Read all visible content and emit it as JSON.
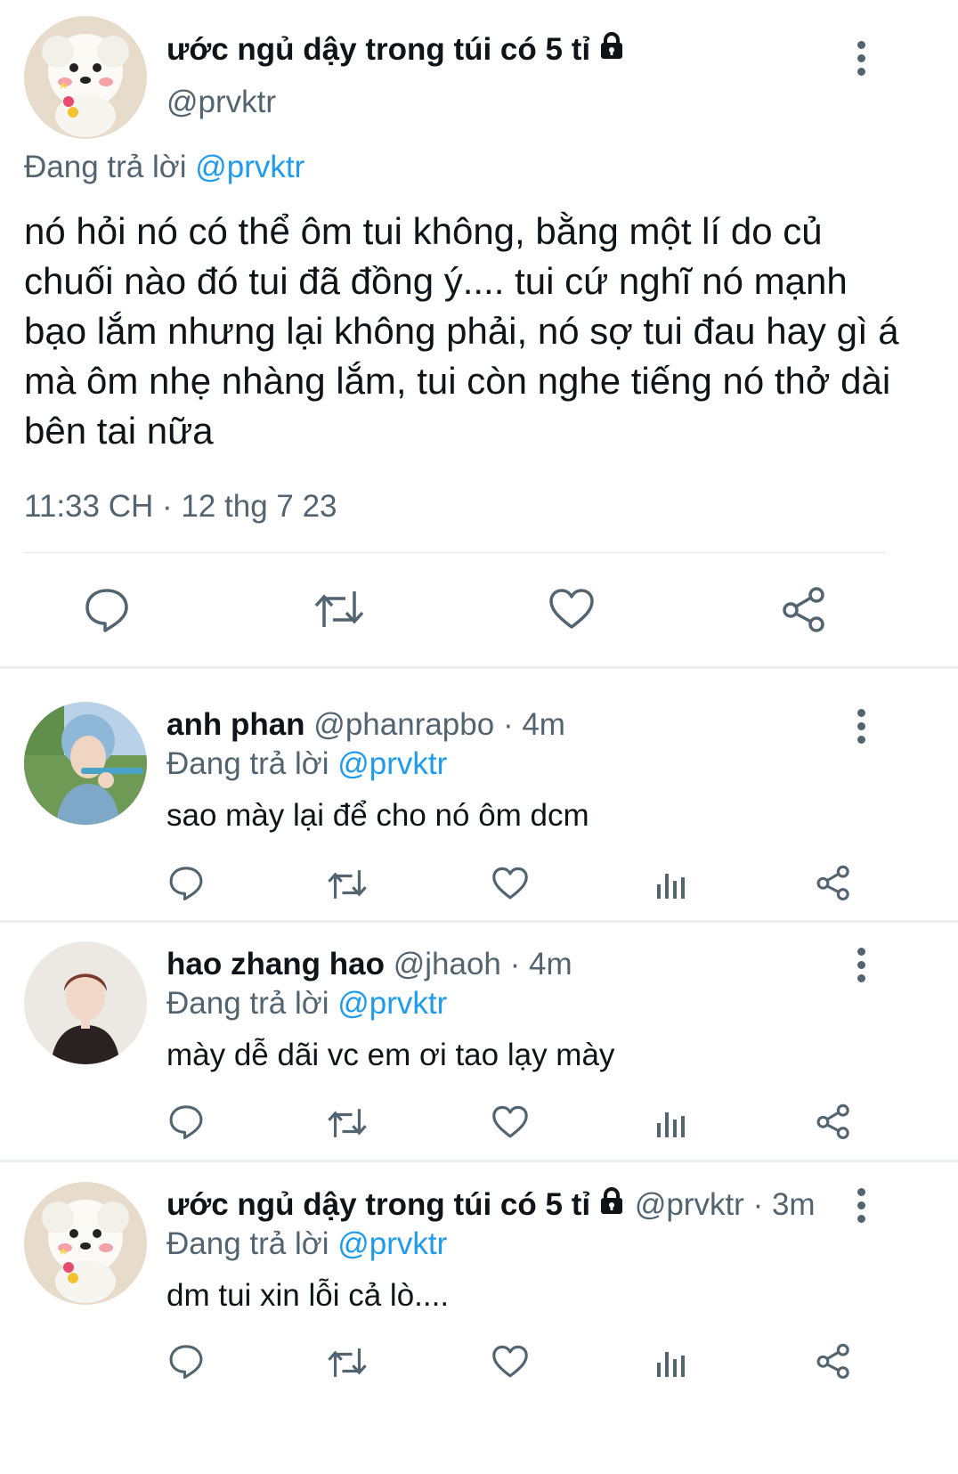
{
  "main_tweet": {
    "display_name": "ước ngủ dậy trong túi có 5 tỉ",
    "handle": "@prvktr",
    "reply_prefix": "Đang trả lời",
    "reply_to": "@prvktr",
    "text": "nó hỏi nó có thể ôm tui không, bằng một lí do củ chuối nào đó tui đã đồng ý.... tui cứ nghĩ nó mạnh bạo lắm nhưng lại không phải, nó sợ tui đau hay gì á mà ôm nhẹ nhàng lắm, tui còn nghe tiếng nó thở dài bên tai nữa",
    "timestamp": "11:33 CH · 12 thg 7 23"
  },
  "replies": [
    {
      "display_name": "anh phan",
      "handle": "@phanrapbo",
      "time": "· 4m",
      "reply_prefix": "Đang trả lời",
      "reply_to": "@prvktr",
      "text": "sao mày lại để cho nó ôm dcm"
    },
    {
      "display_name": "hao zhang hao",
      "handle": "@jhaoh",
      "time": "· 4m",
      "reply_prefix": "Đang trả lời",
      "reply_to": "@prvktr",
      "text": "mày dễ dãi vc em ơi tao lạy mày"
    },
    {
      "display_name": "ước ngủ dậy trong túi có 5 tỉ",
      "handle": "@prvktr",
      "time": "· 3m",
      "reply_prefix": "Đang trả lời",
      "reply_to": "@prvktr",
      "text": "dm tui xin lỗi cả lò...."
    }
  ],
  "icons": [
    "reply-icon",
    "retweet-icon",
    "like-icon",
    "views-icon",
    "share-icon",
    "lock-icon",
    "more-icon"
  ],
  "colors": {
    "link": "#1d9bf0",
    "muted": "#536471",
    "text": "#0f1419"
  }
}
